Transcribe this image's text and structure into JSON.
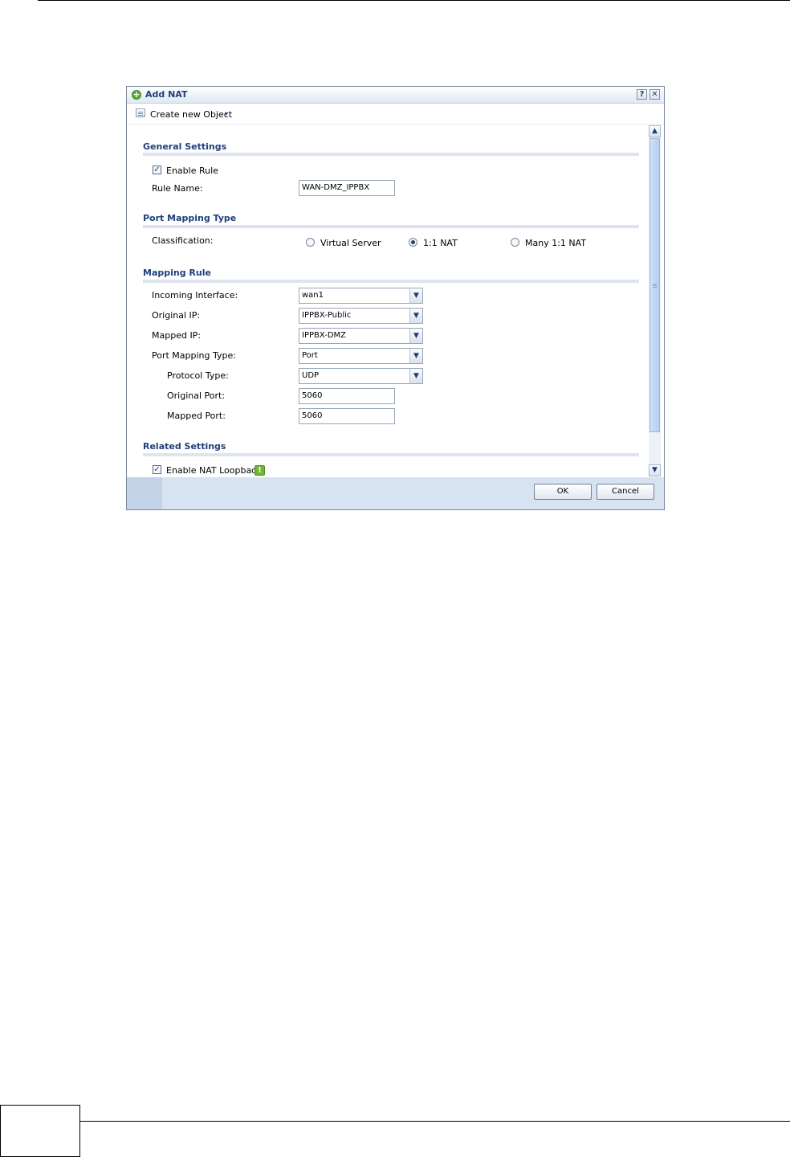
{
  "dialog": {
    "title": "Add NAT",
    "help_label": "?",
    "close_label": "✕"
  },
  "toolbar": {
    "create_object_label": "Create new Object",
    "dropdown_arrow": "▾"
  },
  "general_settings": {
    "title": "General Settings",
    "enable_rule_label": "Enable Rule",
    "enable_rule_checked": true,
    "check_mark": "✓",
    "rule_name_label": "Rule Name:",
    "rule_name_value": "WAN-DMZ_IPPBX"
  },
  "port_mapping_type": {
    "title": "Port Mapping Type",
    "classification_label": "Classification:",
    "options": [
      "Virtual Server",
      "1:1 NAT",
      "Many 1:1 NAT"
    ],
    "selected": "1:1 NAT"
  },
  "mapping_rule": {
    "title": "Mapping Rule",
    "incoming_interface_label": "Incoming Interface:",
    "incoming_interface_value": "wan1",
    "original_ip_label": "Original IP:",
    "original_ip_value": "IPPBX-Public",
    "mapped_ip_label": "Mapped IP:",
    "mapped_ip_value": "IPPBX-DMZ",
    "port_mapping_type_label": "Port Mapping Type:",
    "port_mapping_type_value": "Port",
    "protocol_type_label": "Protocol Type:",
    "protocol_type_value": "UDP",
    "original_port_label": "Original Port:",
    "original_port_value": "5060",
    "mapped_port_label": "Mapped Port:",
    "mapped_port_value": "5060",
    "dropdown_glyph": "▼"
  },
  "related_settings": {
    "title": "Related Settings",
    "enable_nat_loopback_label": "Enable NAT Loopback",
    "enable_nat_loopback_checked": true,
    "info_glyph": "!"
  },
  "scrollbar": {
    "up_glyph": "▲",
    "down_glyph": "▼"
  },
  "footer": {
    "ok_label": "OK",
    "cancel_label": "Cancel"
  },
  "colors": {
    "section_title": "#1f3f7c",
    "footer_bg": "#d8e3f1",
    "scroll_thumb": "#b7cdee"
  }
}
